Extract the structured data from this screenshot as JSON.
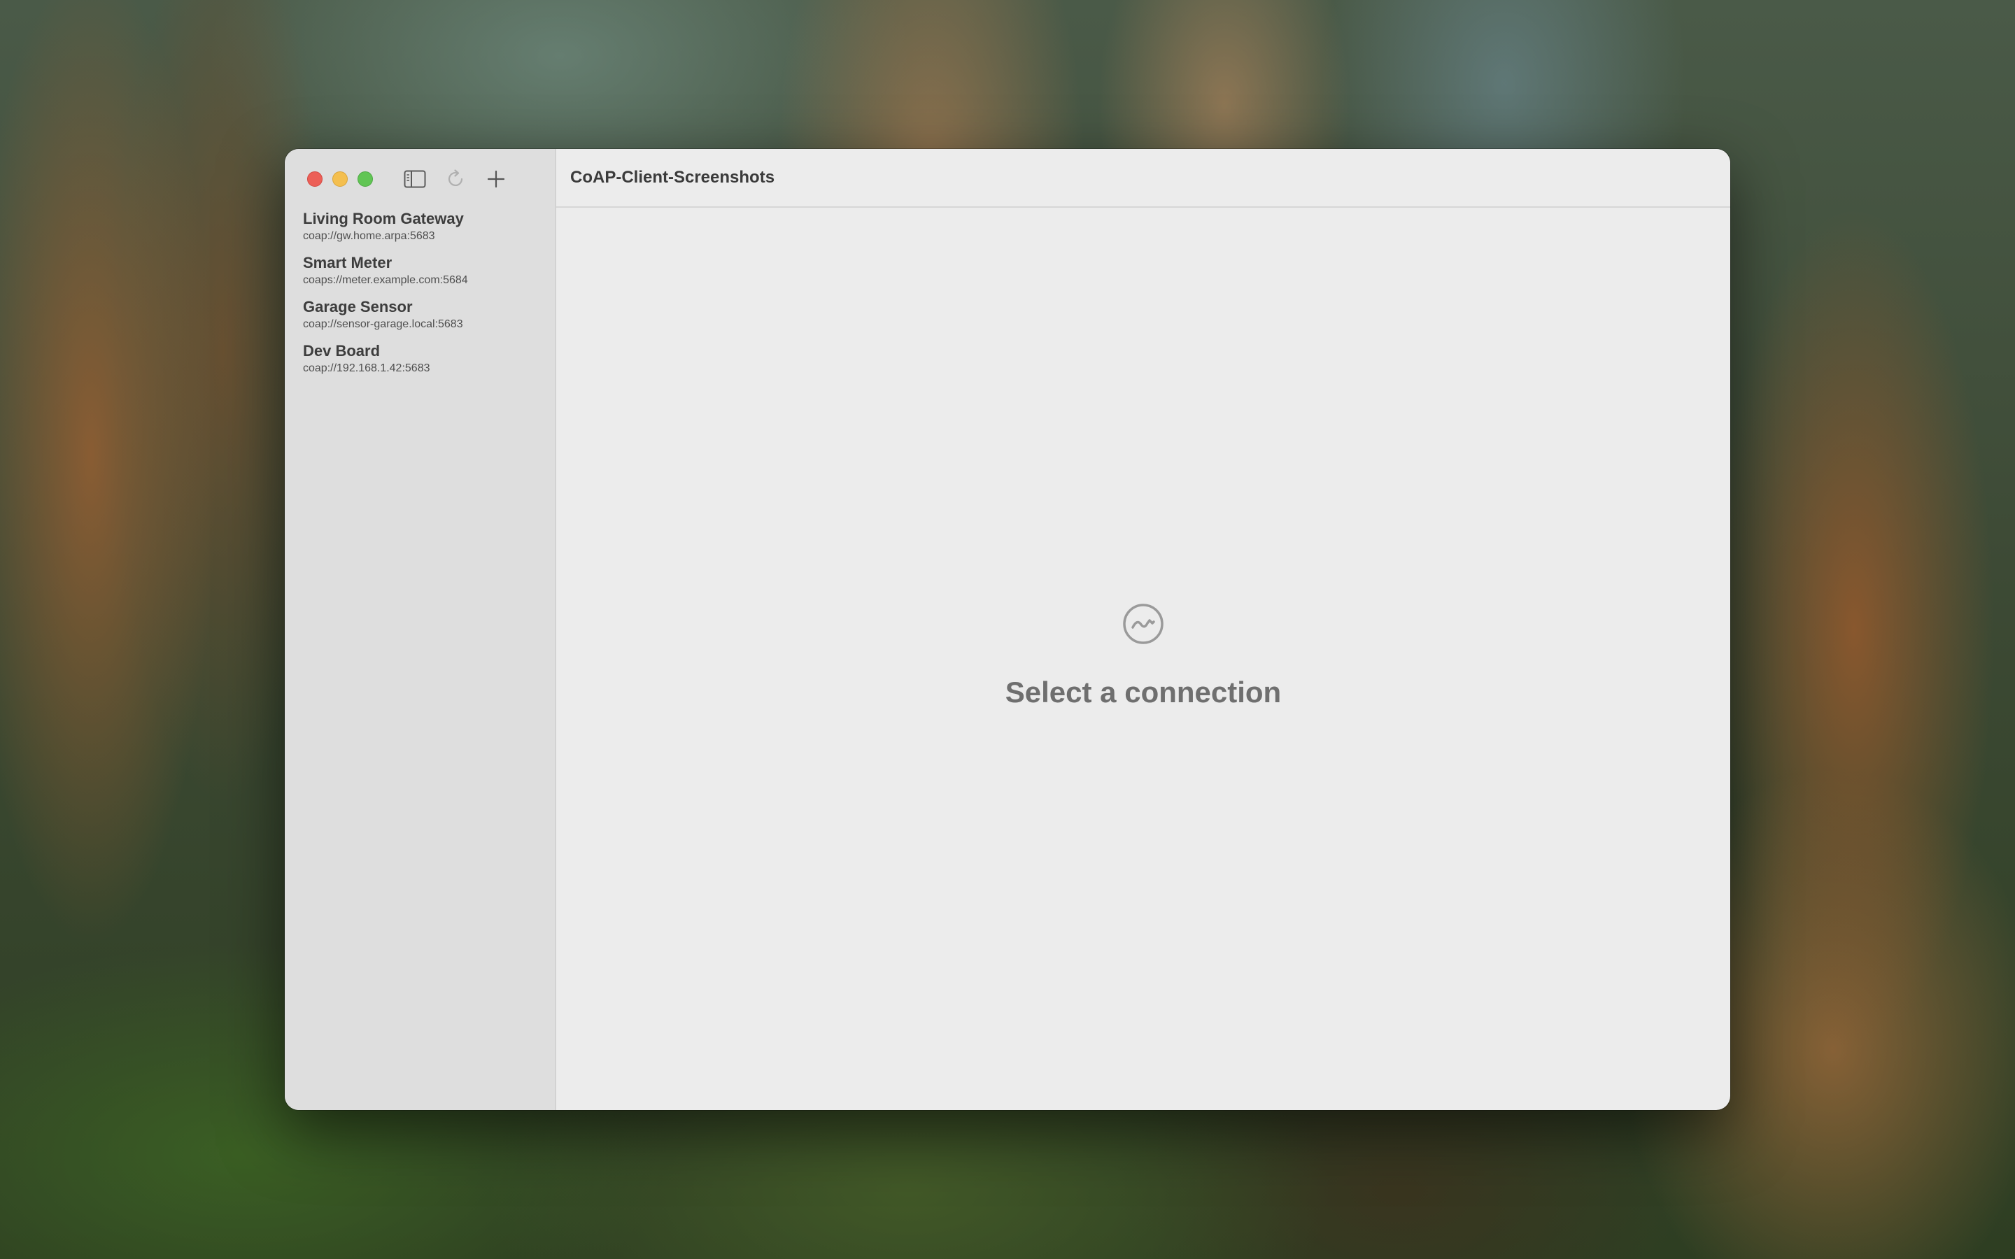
{
  "window": {
    "title": "CoAP-Client-Screenshots"
  },
  "toolbar": {
    "icons": [
      "sidebar-toggle-icon",
      "refresh-icon",
      "plus-icon"
    ]
  },
  "sidebar": {
    "connections": [
      {
        "name": "Living Room Gateway",
        "url": "coap://gw.home.arpa:5683"
      },
      {
        "name": "Smart Meter",
        "url": "coaps://meter.example.com:5684"
      },
      {
        "name": "Garage Sensor",
        "url": "coap://sensor-garage.local:5683"
      },
      {
        "name": "Dev Board",
        "url": "coap://192.168.1.42:5683"
      }
    ]
  },
  "empty_state": {
    "icon": "waveform-circle-icon",
    "title": "Select a connection"
  },
  "colors": {
    "close": "#ec5f57",
    "minimize": "#f4bf4f",
    "maximize": "#61c554"
  }
}
